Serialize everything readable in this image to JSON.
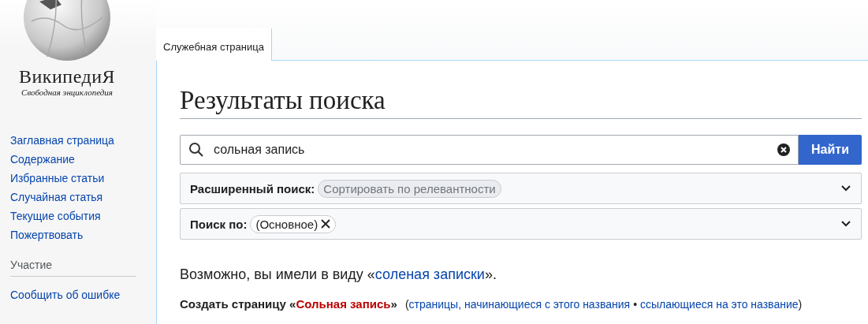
{
  "logo": {
    "wordmark": "ВикипедиЯ",
    "tagline": "Свободная энциклопедия"
  },
  "sidebar": {
    "items": [
      "Заглавная страница",
      "Содержание",
      "Избранные статьи",
      "Случайная статья",
      "Текущие события",
      "Пожертвовать"
    ],
    "section": {
      "heading": "Участие",
      "items": [
        "Сообщить об ошибке"
      ]
    }
  },
  "tabs": [
    {
      "label": "Служебная страница",
      "selected": true
    }
  ],
  "heading": "Результаты поиска",
  "search": {
    "value": "сольная запись",
    "button": "Найти"
  },
  "filters": [
    {
      "label": "Расширенный поиск:",
      "chip": "Сортировать по релевантности",
      "removable": false,
      "expanded": false
    },
    {
      "label": "Поиск по:",
      "chip": "(Основное)",
      "removable": true,
      "expanded": false
    }
  ],
  "suggestion": {
    "prefix": "Возможно, вы имели в виду «",
    "link": "соленая записки",
    "suffix": "»."
  },
  "create": {
    "prefix": "Создать страницу «",
    "link": "Сольная запись",
    "suffix": "»",
    "open": "(",
    "links": [
      "страницы, начинающиеся с этого названия",
      "ссылающиеся на это название"
    ],
    "separator": "•",
    "close": ")"
  }
}
